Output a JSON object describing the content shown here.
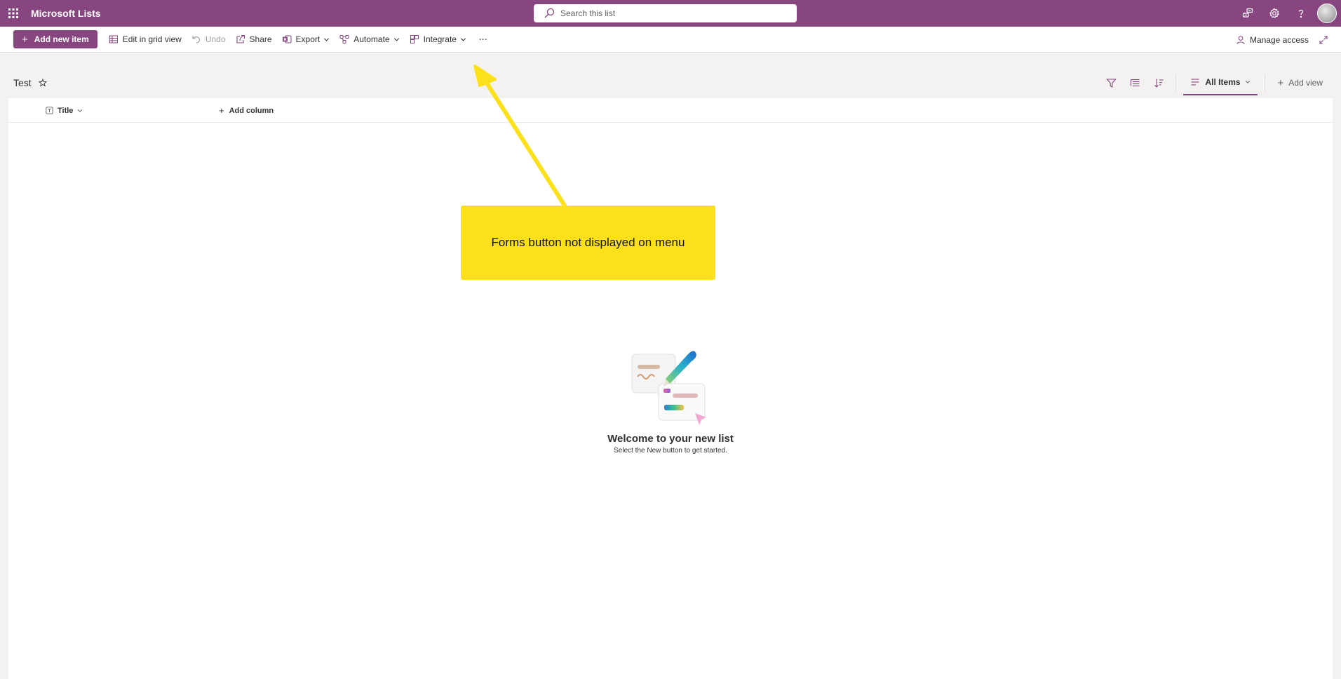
{
  "suite": {
    "app_name": "Microsoft Lists",
    "search_placeholder": "Search this list"
  },
  "command_bar": {
    "add_new_item": "Add new item",
    "edit_grid": "Edit in grid view",
    "undo": "Undo",
    "share": "Share",
    "export": "Export",
    "automate": "Automate",
    "integrate": "Integrate",
    "more": "···",
    "manage_access": "Manage access"
  },
  "list": {
    "title": "Test",
    "view_name": "All Items",
    "add_view": "Add view",
    "columns": {
      "title": "Title",
      "add_column": "Add column"
    },
    "empty_title": "Welcome to your new list",
    "empty_subtitle": "Select the New button to get started."
  },
  "annotation": {
    "text": "Forms button not displayed on menu"
  },
  "colors": {
    "brand": "#874680",
    "callout": "#fbe01a"
  },
  "icons": [
    "waffle-icon",
    "search-icon",
    "share-feedback-icon",
    "gear-icon",
    "help-icon",
    "grid-icon",
    "undo-icon",
    "share-icon",
    "excel-icon",
    "automate-icon",
    "integrate-icon",
    "person-icon",
    "expand-icon",
    "filter-icon",
    "group-icon",
    "sort-icon",
    "view-list-icon",
    "star-icon",
    "text-column-icon"
  ]
}
